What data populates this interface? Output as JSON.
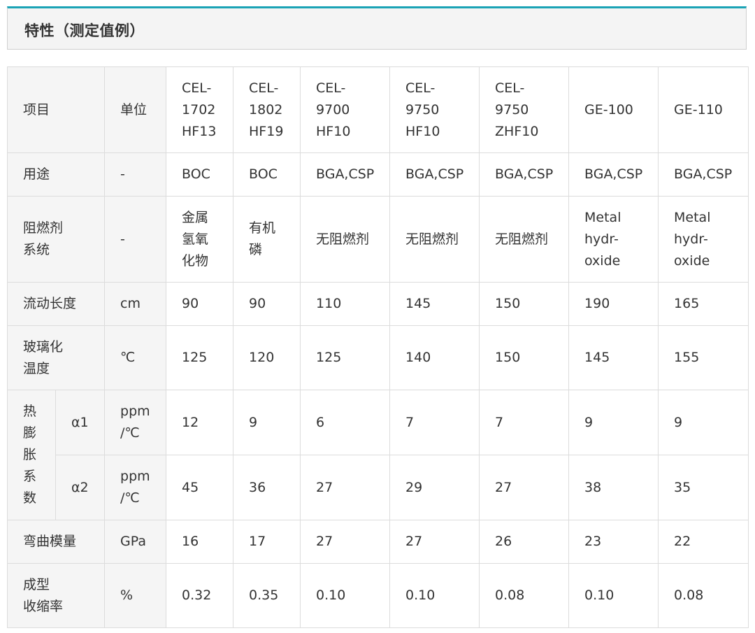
{
  "header": {
    "title": "特性（测定值例）"
  },
  "table": {
    "columns": [
      "项目",
      "单位",
      "CEL-\n1702\nHF13",
      "CEL-\n1802\nHF19",
      "CEL-\n9700\nHF10",
      "CEL-\n9750\nHF10",
      "CEL-\n9750\nZHF10",
      "GE-100",
      "GE-110"
    ],
    "rows": {
      "usage": {
        "label": "用途",
        "unit": "-",
        "values": [
          "BOC",
          "BOC",
          "BGA,CSP",
          "BGA,CSP",
          "BGA,CSP",
          "BGA,CSP",
          "BGA,CSP"
        ]
      },
      "flame": {
        "label": "阻燃剂\n系统",
        "unit": "-",
        "values": [
          "金属\n氢氧\n化物",
          "有机\n磷",
          "无阻燃剂",
          "无阻燃剂",
          "无阻燃剂",
          "Metal\nhydr-\noxide",
          "Metal\nhydr-\noxide"
        ]
      },
      "flow": {
        "label": "流动长度",
        "unit": "cm",
        "values": [
          "90",
          "90",
          "110",
          "145",
          "150",
          "190",
          "165"
        ]
      },
      "tg": {
        "label": "玻璃化\n温度",
        "unit": "℃",
        "values": [
          "125",
          "120",
          "125",
          "140",
          "150",
          "145",
          "155"
        ]
      },
      "cte": {
        "label": "热\n膨\n胀\n系\n数",
        "a1": {
          "label": "α1",
          "unit": "ppm\n/℃",
          "values": [
            "12",
            "9",
            "6",
            "7",
            "7",
            "9",
            "9"
          ]
        },
        "a2": {
          "label": "α2",
          "unit": "ppm\n/℃",
          "values": [
            "45",
            "36",
            "27",
            "29",
            "27",
            "38",
            "35"
          ]
        }
      },
      "modulus": {
        "label": "弯曲模量",
        "unit": "GPa",
        "values": [
          "16",
          "17",
          "27",
          "27",
          "26",
          "23",
          "22"
        ]
      },
      "shrink": {
        "label": "成型\n收缩率",
        "unit": "%",
        "values": [
          "0.32",
          "0.35",
          "0.10",
          "0.10",
          "0.08",
          "0.10",
          "0.08"
        ]
      }
    }
  }
}
